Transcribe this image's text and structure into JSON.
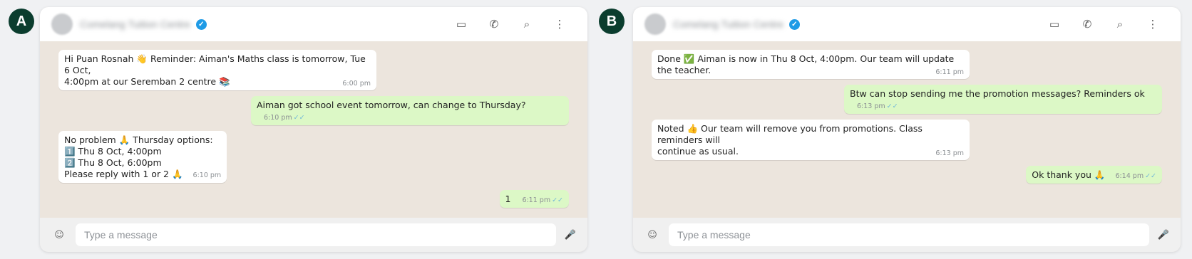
{
  "panels": [
    {
      "label": "A",
      "contact_name": "Comelang Tuition Centre",
      "messages": [
        {
          "dir": "in",
          "text": "Hi Puan Rosnah 👋 Reminder: Aiman's Maths class is tomorrow, Tue 6 Oct,\n4:00pm at our Seremban 2 centre 📚",
          "time": "6:00 pm"
        },
        {
          "dir": "out",
          "text": "Aiman got school event tomorrow, can change to Thursday?",
          "time": "6:10 pm",
          "ticks": "✓✓"
        },
        {
          "dir": "in",
          "text": "No problem 🙏 Thursday options:\n1️⃣ Thu 8 Oct, 4:00pm\n2️⃣ Thu 8 Oct, 6:00pm\nPlease reply with 1 or 2 🙏",
          "time": "6:10 pm"
        },
        {
          "dir": "out",
          "text": "1",
          "time": "6:11 pm",
          "ticks": "✓✓"
        }
      ],
      "placeholder": "Type a message"
    },
    {
      "label": "B",
      "contact_name": "Comelang Tuition Centre",
      "messages": [
        {
          "dir": "in",
          "text": "Done ✅ Aiman is now in Thu 8 Oct, 4:00pm. Our team will update the teacher.",
          "time": "6:11 pm"
        },
        {
          "dir": "out",
          "text": "Btw can stop sending me the promotion messages? Reminders ok",
          "time": "6:13 pm",
          "ticks": "✓✓"
        },
        {
          "dir": "in",
          "text": "Noted 👍 Our team will remove you from promotions. Class reminders will\ncontinue as usual.",
          "time": "6:13 pm"
        },
        {
          "dir": "out",
          "text": "Ok thank you 🙏",
          "time": "6:14 pm",
          "ticks": "✓✓"
        }
      ],
      "placeholder": "Type a message"
    }
  ],
  "icons": {
    "verified": "✓",
    "video": "▭",
    "call": "✆",
    "search": "⌕",
    "menu": "⋮",
    "emoji": "☺",
    "mic": "🎤"
  },
  "colors": {
    "chat_bg": "#ece5dd",
    "incoming": "#ffffff",
    "outgoing": "#dcf8c6",
    "badge": "#0b3d2e",
    "verified": "#1f9be6"
  }
}
